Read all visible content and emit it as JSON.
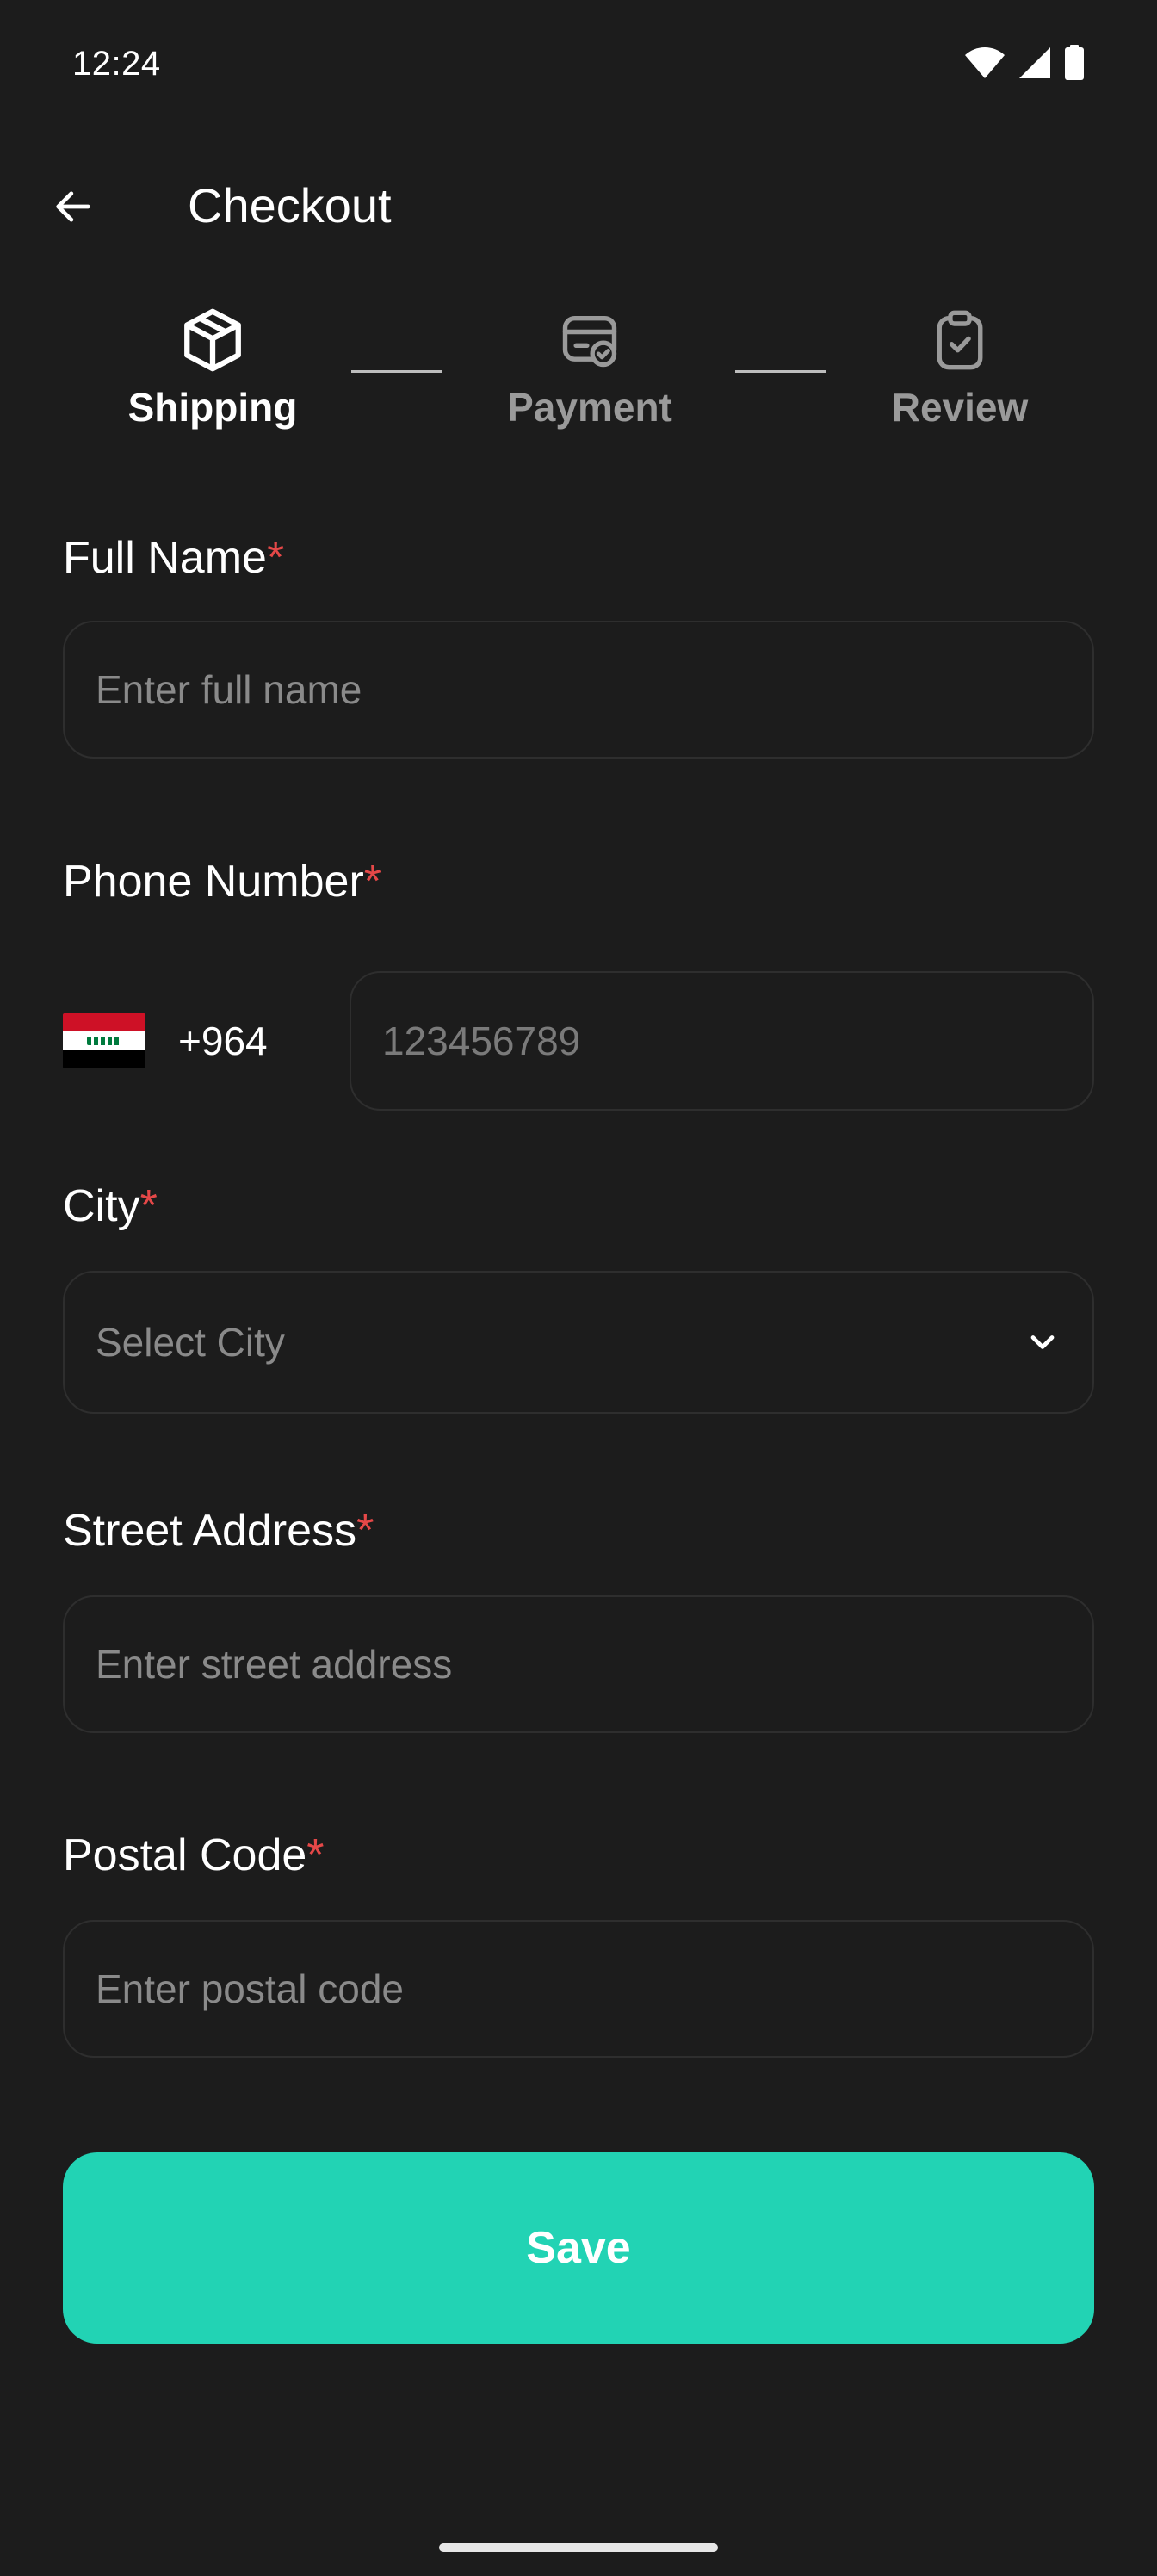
{
  "status_bar": {
    "time": "12:24",
    "icons": [
      "wifi-icon",
      "signal-icon",
      "battery-icon"
    ]
  },
  "app_bar": {
    "back_icon": "arrow-left-icon",
    "title": "Checkout"
  },
  "stepper": {
    "steps": [
      {
        "label": "Shipping",
        "icon": "box-icon",
        "active": true
      },
      {
        "label": "Payment",
        "icon": "card-check-icon",
        "active": false
      },
      {
        "label": "Review",
        "icon": "clipboard-check-icon",
        "active": false
      }
    ]
  },
  "form": {
    "full_name": {
      "label": "Full Name",
      "required": "*",
      "placeholder": "Enter full name",
      "value": ""
    },
    "phone": {
      "label": "Phone Number",
      "required": "*",
      "dial_code": "+964",
      "country_flag": "iraq-flag",
      "placeholder": "123456789",
      "value": ""
    },
    "city": {
      "label": "City",
      "required": "*",
      "placeholder": "Select City",
      "icon": "chevron-down-icon"
    },
    "street": {
      "label": "Street Address",
      "required": "*",
      "placeholder": "Enter street address",
      "value": ""
    },
    "postal": {
      "label": "Postal Code",
      "required": "*",
      "placeholder": "Enter postal code",
      "value": ""
    }
  },
  "actions": {
    "save_label": "Save"
  },
  "colors": {
    "background": "#1c1c1c",
    "accent": "#22d3b4",
    "required": "#e54848",
    "field_border": "#2e2e2e",
    "placeholder": "#8a8a8a"
  }
}
